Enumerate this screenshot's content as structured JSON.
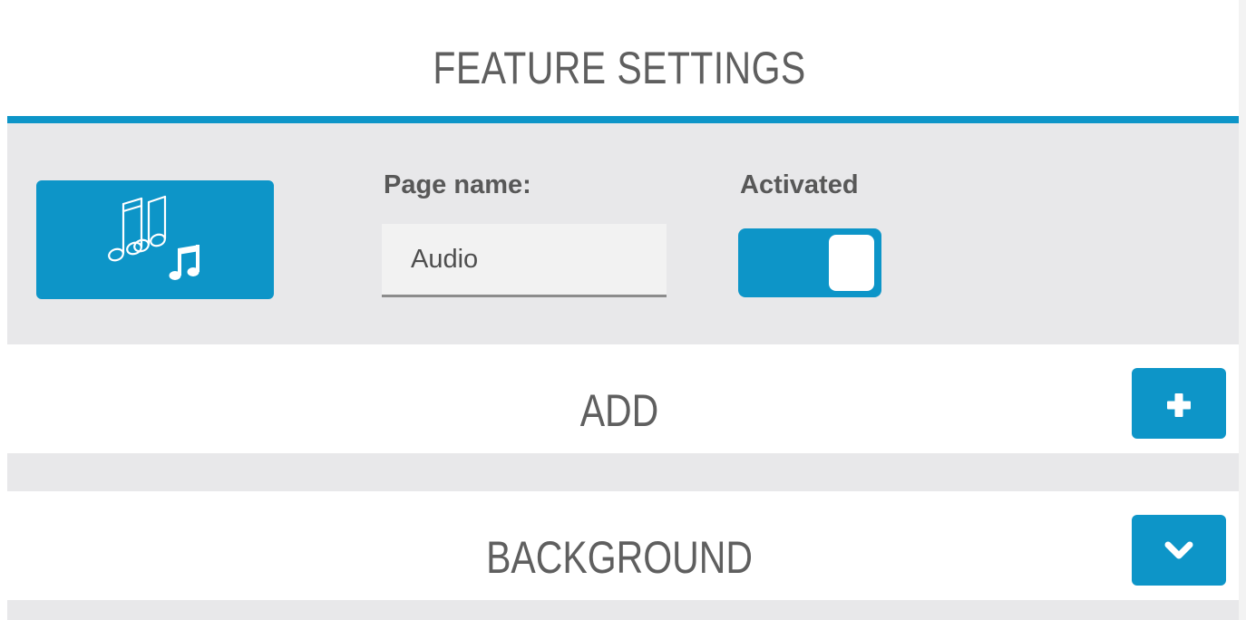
{
  "header": {
    "title": "FEATURE SETTINGS"
  },
  "feature": {
    "icon": "music-notes-icon",
    "page_name_label": "Page name:",
    "page_name_value": "Audio",
    "activated_label": "Activated",
    "activated": true
  },
  "sections": {
    "add": {
      "title": "ADD",
      "button_icon": "plus-icon"
    },
    "background": {
      "title": "BACKGROUND",
      "button_icon": "chevron-down-icon"
    }
  },
  "colors": {
    "accent": "#0d95c8",
    "panel": "#e8e8ea",
    "title_text": "#5f5f5f"
  }
}
